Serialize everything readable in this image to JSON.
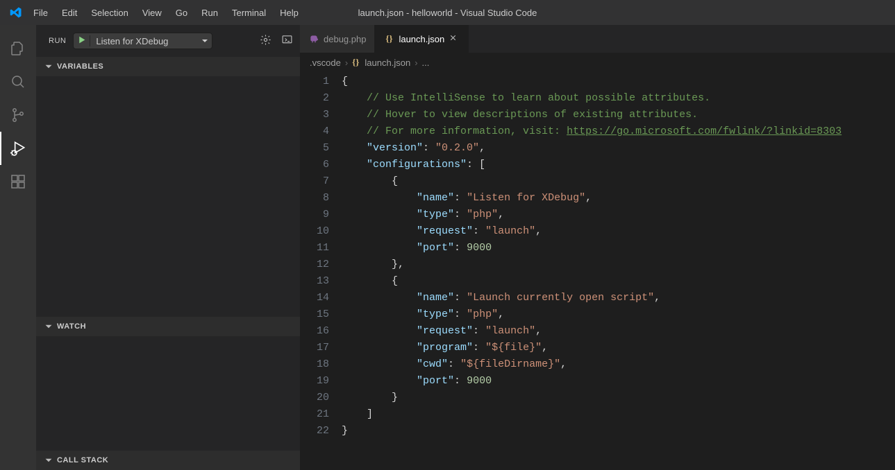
{
  "window": {
    "title": "launch.json - helloworld - Visual Studio Code"
  },
  "menu": {
    "items": [
      "File",
      "Edit",
      "Selection",
      "View",
      "Go",
      "Run",
      "Terminal",
      "Help"
    ]
  },
  "run_panel": {
    "label": "RUN",
    "config": "Listen for XDebug"
  },
  "sections": {
    "variables": "VARIABLES",
    "watch": "WATCH",
    "callstack": "CALL STACK"
  },
  "tabs": [
    {
      "label": "debug.php",
      "active": false,
      "icon": "elephant-icon"
    },
    {
      "label": "launch.json",
      "active": true,
      "icon": "json-icon"
    }
  ],
  "breadcrumbs": {
    "folder": ".vscode",
    "file": "launch.json",
    "more": "..."
  },
  "code": {
    "comment1": "// Use IntelliSense to learn about possible attributes.",
    "comment2": "// Hover to view descriptions of existing attributes.",
    "comment3a": "// For more information, visit: ",
    "comment3b": "https://go.microsoft.com/fwlink/?linkid=8303",
    "version_key": "\"version\"",
    "version_val": "\"0.2.0\"",
    "configs_key": "\"configurations\"",
    "name_key": "\"name\"",
    "type_key": "\"type\"",
    "request_key": "\"request\"",
    "port_key": "\"port\"",
    "program_key": "\"program\"",
    "cwd_key": "\"cwd\"",
    "cfg1_name": "\"Listen for XDebug\"",
    "cfg2_name": "\"Launch currently open script\"",
    "php_val": "\"php\"",
    "launch_val": "\"launch\"",
    "program_val": "\"${file}\"",
    "cwd_val": "\"${fileDirname}\"",
    "port_val": "9000"
  },
  "line_count": 22
}
